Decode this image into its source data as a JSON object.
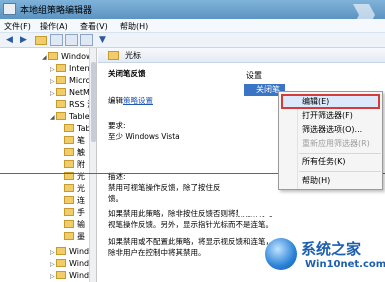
{
  "window": {
    "title": "本地组策略编辑器"
  },
  "menubar": {
    "items": [
      "文件(F)",
      "操作(A)",
      "查看(V)",
      "帮助(H)"
    ]
  },
  "tree": {
    "items": [
      {
        "label": "Windows",
        "expanded": true
      },
      {
        "label": "Intern"
      },
      {
        "label": "Micro"
      },
      {
        "label": "NetM"
      },
      {
        "label": "RSS 源"
      },
      {
        "label": "Tablet",
        "expanded": true
      },
      {
        "label": "Tabl"
      },
      {
        "label": "笔"
      },
      {
        "label": "触"
      },
      {
        "label": "附"
      },
      {
        "label": "光"
      },
      {
        "label": "光"
      },
      {
        "label": "连"
      },
      {
        "label": "手"
      },
      {
        "label": "输"
      },
      {
        "label": "墨"
      },
      {
        "label": "Windo"
      },
      {
        "label": "Windo"
      },
      {
        "label": "Windo"
      }
    ]
  },
  "content": {
    "header": "光标",
    "policy_name": "关闭笔反馈",
    "edit_prefix": "编辑",
    "edit_link": "策略设置",
    "requirements_label": "要求:",
    "requirements_value": "至少 Windows Vista",
    "desc_label": "描述:",
    "desc_line1": "禁用可视笔操作反馈，除了按住反",
    "desc_line2": "馈。",
    "desc_para2": "如果禁用此策略，除非按住反馈否则将禁用所有可视笔操作反馈。另外，显示指针光标而不是连笔。",
    "desc_para3": "如果禁用或不配置此策略，将显示视反馈和连笔，除非用户在控制中将其禁用。"
  },
  "list": {
    "header": "设置",
    "selected_row": "关闭笔反馈"
  },
  "context_menu": {
    "items": [
      {
        "label": "编辑(E)",
        "highlighted": true
      },
      {
        "label": "打开筛选器(F)"
      },
      {
        "label": "筛选器选项(O)..."
      },
      {
        "label": "重新应用筛选器(R)",
        "disabled": true
      },
      {
        "label": "所有任务(K)"
      },
      {
        "label": "帮助(H)"
      }
    ]
  },
  "watermark": {
    "brand": "系统之家",
    "site": "Win10net.com"
  }
}
